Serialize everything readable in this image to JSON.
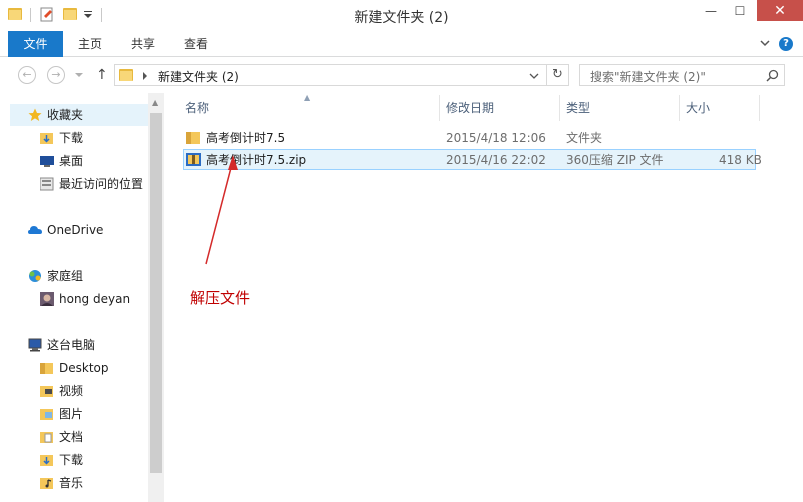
{
  "window": {
    "title": "新建文件夹 (2)",
    "close_glyph": "✕",
    "min_glyph": "—",
    "max_glyph": "☐"
  },
  "ribbon": {
    "tabs": [
      "文件",
      "主页",
      "共享",
      "查看"
    ],
    "help_glyph": "?"
  },
  "address": {
    "path": "新建文件夹 (2)",
    "back_glyph": "←",
    "forward_glyph": "→",
    "up_glyph": "↑",
    "refresh_glyph": "↻",
    "search_placeholder": "搜索\"新建文件夹 (2)\""
  },
  "nav": {
    "items": [
      {
        "label": "收藏夹",
        "icon": "star-icon"
      },
      {
        "label": "下载",
        "icon": "download-folder-icon"
      },
      {
        "label": "桌面",
        "icon": "desktop-icon"
      },
      {
        "label": "最近访问的位置",
        "icon": "recent-places-icon"
      },
      {
        "label": "OneDrive",
        "icon": "cloud-icon"
      },
      {
        "label": "家庭组",
        "icon": "homegroup-icon"
      },
      {
        "label": "hong deyan",
        "icon": "user-avatar-icon"
      },
      {
        "label": "这台电脑",
        "icon": "computer-icon"
      },
      {
        "label": "Desktop",
        "icon": "folder-icon"
      },
      {
        "label": "视频",
        "icon": "video-folder-icon"
      },
      {
        "label": "图片",
        "icon": "pictures-folder-icon"
      },
      {
        "label": "文档",
        "icon": "documents-folder-icon"
      },
      {
        "label": "下载",
        "icon": "download-folder-icon"
      },
      {
        "label": "音乐",
        "icon": "music-folder-icon"
      }
    ]
  },
  "table": {
    "columns": [
      "名称",
      "修改日期",
      "类型",
      "大小"
    ],
    "rows": [
      {
        "name": "高考倒计时7.5",
        "date": "2015/4/18 12:06",
        "type": "文件夹",
        "size": "",
        "icon": "folder-icon"
      },
      {
        "name": "高考倒计时7.5.zip",
        "date": "2015/4/16 22:02",
        "type": "360压缩 ZIP 文件",
        "size": "418 KB",
        "icon": "zip-archive-icon"
      }
    ]
  },
  "annotation": {
    "text": "解压文件",
    "color": "#c00000"
  },
  "colors": {
    "accent": "#1979ca",
    "selection": "#e5f3fb",
    "close": "#c7504a"
  }
}
